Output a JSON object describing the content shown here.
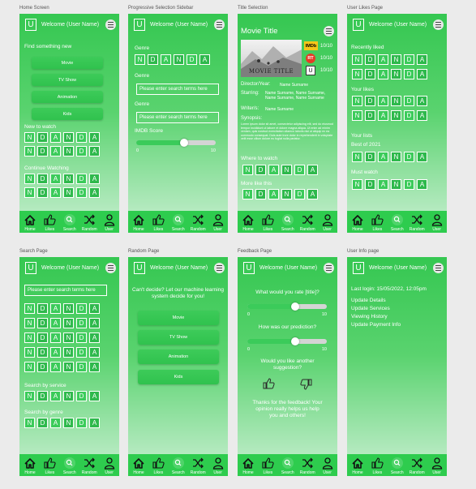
{
  "common": {
    "welcome": "Welcome (User Name)",
    "logo_letter": "U",
    "nav": [
      "Home",
      "Likes",
      "Search",
      "Random",
      "User"
    ],
    "tile_letters": [
      "N",
      "D",
      "A",
      "N",
      "D",
      "A"
    ]
  },
  "home": {
    "label": "Home Screen",
    "find": "Find something new",
    "buttons": [
      "Movie",
      "TV Show",
      "Animation",
      "Kids"
    ],
    "new_to_watch": "New to watch",
    "continue_watching": "Continue Watching"
  },
  "progressive": {
    "label": "Progressive Selection Sidebar",
    "genre1": "Genre",
    "genre2": "Genre",
    "search_placeholder": "Please enter search terms here",
    "genre3": "Genre",
    "search_placeholder2": "Please enter search terms here",
    "imdb": "IMDB Score",
    "slider_min": "0",
    "slider_max": "10",
    "imdb_value": 0.6
  },
  "title": {
    "label": "Title Selection",
    "movie_title": "Movie Title",
    "poster_text": "MOVIE TITLE",
    "imdb_badge": "IMDb",
    "rt_badge": "RT",
    "u_badge": "U",
    "scores": [
      "10/10",
      "10/10",
      "10/10"
    ],
    "director_label": "Director/Year:",
    "director_value": "Name Surname",
    "starring_label": "Starring:",
    "starring_value": "Name Surname, Name Surname, Name Surname, Name Surname",
    "writers_label": "Writer/s:",
    "writers_value": "Name Surname",
    "synopsis_label": "Synopsis:",
    "synopsis_text": "Lorem ipsum dolor sit amet, consectetur adipiscing elit, sed do eiusmod tempor incididunt ut labore et dolore magna aliqua. Ut enim ad minim veniam, quis nostrud exercitation ullamco laboris nisi ut aliquip ex ea commodo consequat. Duis aute irure dolor in reprehenderit in voluptate velit esse cillum dolore eu fugiat nulla pariatur.",
    "where_to_watch": "Where to watch",
    "more_like": "More like this"
  },
  "likes": {
    "label": "User Likes Page",
    "recently_liked": "Recently liked",
    "your_likes": "Your likes",
    "your_lists": "Your lists",
    "best_of": "Best of 2021",
    "must_watch": "Must watch"
  },
  "search": {
    "label": "Search Page",
    "placeholder": "Please enter search terms here",
    "by_service": "Search by service",
    "by_genre": "Search by genre"
  },
  "random": {
    "label": "Random Page",
    "prompt": "Can't decide? Let our machine learning system decide for you!",
    "buttons": [
      "Movie",
      "TV Show",
      "Animation",
      "Kids"
    ]
  },
  "feedback": {
    "label": "Feedback Page",
    "rate_q": "What would you rate [title]?",
    "slider_min": "0",
    "slider_max": "10",
    "rate_value": 0.6,
    "pred_q": "How was our prediction?",
    "pred_value": 0.6,
    "another_q": "Would you like another suggestion?",
    "thanks": "Thanks for the feedback! Your opinion really helps us help you and others!"
  },
  "userinfo": {
    "label": "User Info page",
    "last_login": "Last login: 15/05/2022, 12:05pm",
    "links": [
      "Update Details",
      "Update Services",
      "Viewing History",
      "Update Payment Info"
    ]
  },
  "colors": {
    "accent": "#2ecc4e",
    "light": "#c9efd2"
  }
}
